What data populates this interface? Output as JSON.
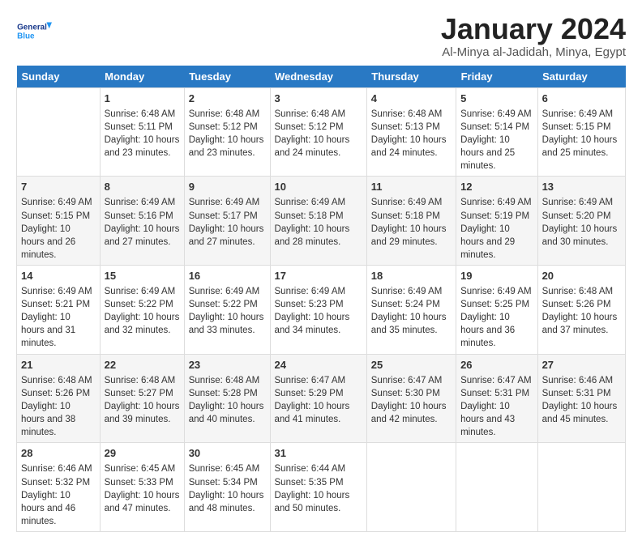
{
  "logo": {
    "general": "General",
    "blue": "Blue"
  },
  "title": "January 2024",
  "location": "Al-Minya al-Jadidah, Minya, Egypt",
  "days_of_week": [
    "Sunday",
    "Monday",
    "Tuesday",
    "Wednesday",
    "Thursday",
    "Friday",
    "Saturday"
  ],
  "weeks": [
    [
      {
        "day": "",
        "sunrise": "",
        "sunset": "",
        "daylight": ""
      },
      {
        "day": "1",
        "sunrise": "Sunrise: 6:48 AM",
        "sunset": "Sunset: 5:11 PM",
        "daylight": "Daylight: 10 hours and 23 minutes."
      },
      {
        "day": "2",
        "sunrise": "Sunrise: 6:48 AM",
        "sunset": "Sunset: 5:12 PM",
        "daylight": "Daylight: 10 hours and 23 minutes."
      },
      {
        "day": "3",
        "sunrise": "Sunrise: 6:48 AM",
        "sunset": "Sunset: 5:12 PM",
        "daylight": "Daylight: 10 hours and 24 minutes."
      },
      {
        "day": "4",
        "sunrise": "Sunrise: 6:48 AM",
        "sunset": "Sunset: 5:13 PM",
        "daylight": "Daylight: 10 hours and 24 minutes."
      },
      {
        "day": "5",
        "sunrise": "Sunrise: 6:49 AM",
        "sunset": "Sunset: 5:14 PM",
        "daylight": "Daylight: 10 hours and 25 minutes."
      },
      {
        "day": "6",
        "sunrise": "Sunrise: 6:49 AM",
        "sunset": "Sunset: 5:15 PM",
        "daylight": "Daylight: 10 hours and 25 minutes."
      }
    ],
    [
      {
        "day": "7",
        "sunrise": "Sunrise: 6:49 AM",
        "sunset": "Sunset: 5:15 PM",
        "daylight": "Daylight: 10 hours and 26 minutes."
      },
      {
        "day": "8",
        "sunrise": "Sunrise: 6:49 AM",
        "sunset": "Sunset: 5:16 PM",
        "daylight": "Daylight: 10 hours and 27 minutes."
      },
      {
        "day": "9",
        "sunrise": "Sunrise: 6:49 AM",
        "sunset": "Sunset: 5:17 PM",
        "daylight": "Daylight: 10 hours and 27 minutes."
      },
      {
        "day": "10",
        "sunrise": "Sunrise: 6:49 AM",
        "sunset": "Sunset: 5:18 PM",
        "daylight": "Daylight: 10 hours and 28 minutes."
      },
      {
        "day": "11",
        "sunrise": "Sunrise: 6:49 AM",
        "sunset": "Sunset: 5:18 PM",
        "daylight": "Daylight: 10 hours and 29 minutes."
      },
      {
        "day": "12",
        "sunrise": "Sunrise: 6:49 AM",
        "sunset": "Sunset: 5:19 PM",
        "daylight": "Daylight: 10 hours and 29 minutes."
      },
      {
        "day": "13",
        "sunrise": "Sunrise: 6:49 AM",
        "sunset": "Sunset: 5:20 PM",
        "daylight": "Daylight: 10 hours and 30 minutes."
      }
    ],
    [
      {
        "day": "14",
        "sunrise": "Sunrise: 6:49 AM",
        "sunset": "Sunset: 5:21 PM",
        "daylight": "Daylight: 10 hours and 31 minutes."
      },
      {
        "day": "15",
        "sunrise": "Sunrise: 6:49 AM",
        "sunset": "Sunset: 5:22 PM",
        "daylight": "Daylight: 10 hours and 32 minutes."
      },
      {
        "day": "16",
        "sunrise": "Sunrise: 6:49 AM",
        "sunset": "Sunset: 5:22 PM",
        "daylight": "Daylight: 10 hours and 33 minutes."
      },
      {
        "day": "17",
        "sunrise": "Sunrise: 6:49 AM",
        "sunset": "Sunset: 5:23 PM",
        "daylight": "Daylight: 10 hours and 34 minutes."
      },
      {
        "day": "18",
        "sunrise": "Sunrise: 6:49 AM",
        "sunset": "Sunset: 5:24 PM",
        "daylight": "Daylight: 10 hours and 35 minutes."
      },
      {
        "day": "19",
        "sunrise": "Sunrise: 6:49 AM",
        "sunset": "Sunset: 5:25 PM",
        "daylight": "Daylight: 10 hours and 36 minutes."
      },
      {
        "day": "20",
        "sunrise": "Sunrise: 6:48 AM",
        "sunset": "Sunset: 5:26 PM",
        "daylight": "Daylight: 10 hours and 37 minutes."
      }
    ],
    [
      {
        "day": "21",
        "sunrise": "Sunrise: 6:48 AM",
        "sunset": "Sunset: 5:26 PM",
        "daylight": "Daylight: 10 hours and 38 minutes."
      },
      {
        "day": "22",
        "sunrise": "Sunrise: 6:48 AM",
        "sunset": "Sunset: 5:27 PM",
        "daylight": "Daylight: 10 hours and 39 minutes."
      },
      {
        "day": "23",
        "sunrise": "Sunrise: 6:48 AM",
        "sunset": "Sunset: 5:28 PM",
        "daylight": "Daylight: 10 hours and 40 minutes."
      },
      {
        "day": "24",
        "sunrise": "Sunrise: 6:47 AM",
        "sunset": "Sunset: 5:29 PM",
        "daylight": "Daylight: 10 hours and 41 minutes."
      },
      {
        "day": "25",
        "sunrise": "Sunrise: 6:47 AM",
        "sunset": "Sunset: 5:30 PM",
        "daylight": "Daylight: 10 hours and 42 minutes."
      },
      {
        "day": "26",
        "sunrise": "Sunrise: 6:47 AM",
        "sunset": "Sunset: 5:31 PM",
        "daylight": "Daylight: 10 hours and 43 minutes."
      },
      {
        "day": "27",
        "sunrise": "Sunrise: 6:46 AM",
        "sunset": "Sunset: 5:31 PM",
        "daylight": "Daylight: 10 hours and 45 minutes."
      }
    ],
    [
      {
        "day": "28",
        "sunrise": "Sunrise: 6:46 AM",
        "sunset": "Sunset: 5:32 PM",
        "daylight": "Daylight: 10 hours and 46 minutes."
      },
      {
        "day": "29",
        "sunrise": "Sunrise: 6:45 AM",
        "sunset": "Sunset: 5:33 PM",
        "daylight": "Daylight: 10 hours and 47 minutes."
      },
      {
        "day": "30",
        "sunrise": "Sunrise: 6:45 AM",
        "sunset": "Sunset: 5:34 PM",
        "daylight": "Daylight: 10 hours and 48 minutes."
      },
      {
        "day": "31",
        "sunrise": "Sunrise: 6:44 AM",
        "sunset": "Sunset: 5:35 PM",
        "daylight": "Daylight: 10 hours and 50 minutes."
      },
      {
        "day": "",
        "sunrise": "",
        "sunset": "",
        "daylight": ""
      },
      {
        "day": "",
        "sunrise": "",
        "sunset": "",
        "daylight": ""
      },
      {
        "day": "",
        "sunrise": "",
        "sunset": "",
        "daylight": ""
      }
    ]
  ]
}
